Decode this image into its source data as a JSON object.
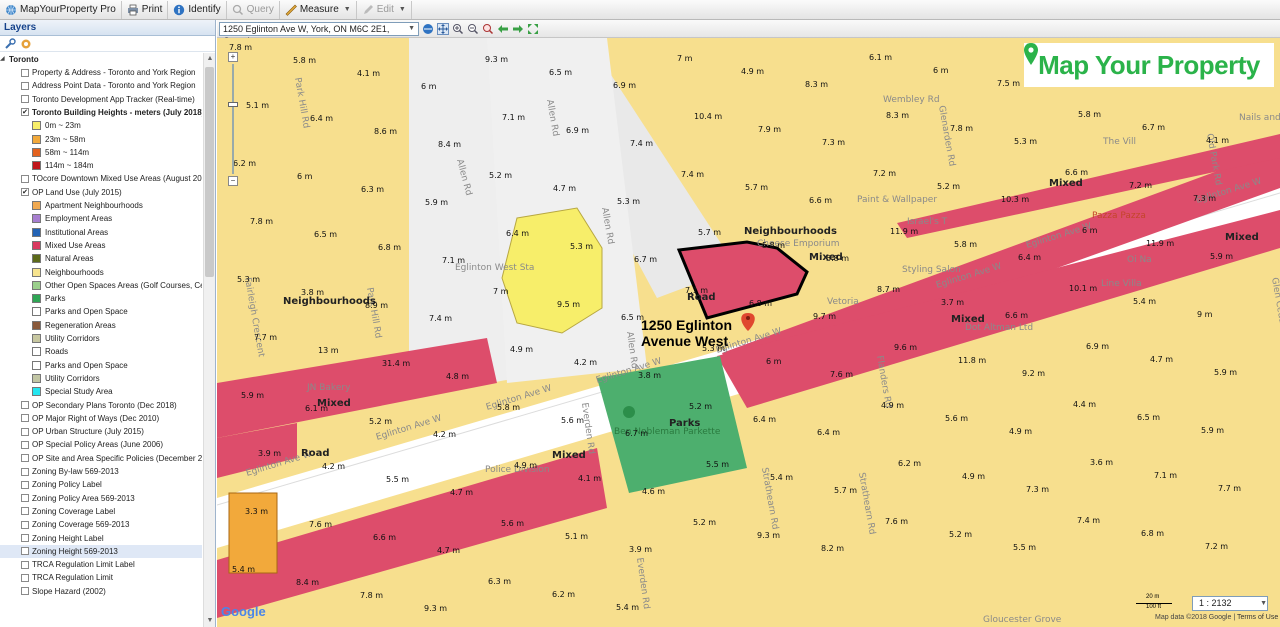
{
  "toolbar": {
    "app_name": "MapYourProperty Pro",
    "print": "Print",
    "identify": "Identify",
    "query": "Query",
    "measure": "Measure",
    "edit": "Edit"
  },
  "layers_panel": {
    "title": "Layers",
    "root": "Toronto",
    "items": [
      {
        "label": "Property & Address - Toronto and York Region",
        "checked": false
      },
      {
        "label": "Address Point Data - Toronto and York Region",
        "checked": false
      },
      {
        "label": "Toronto Development App Tracker (Real-time)",
        "checked": false
      },
      {
        "label": "Toronto Building Heights - meters (July 2018)",
        "checked": true,
        "bold": true
      },
      {
        "label": "0m ~ 23m",
        "swatch": "#f7ee6a",
        "legend": true
      },
      {
        "label": "23m ~ 58m",
        "swatch": "#f2a93b",
        "legend": true
      },
      {
        "label": "58m ~ 114m",
        "swatch": "#e3621e",
        "legend": true
      },
      {
        "label": "114m ~ 184m",
        "swatch": "#c0161b",
        "legend": true
      },
      {
        "label": "TOcore Downtown Mixed Use Areas (August 2018)",
        "checked": false
      },
      {
        "label": "OP Land Use (July 2015)",
        "checked": true
      },
      {
        "label": "Apartment Neighbourhoods",
        "swatch": "#f0a951",
        "legend": true
      },
      {
        "label": "Employment Areas",
        "swatch": "#a77ed0",
        "legend": true
      },
      {
        "label": "Institutional Areas",
        "swatch": "#2363b5",
        "legend": true
      },
      {
        "label": "Mixed Use Areas",
        "swatch": "#d9395f",
        "legend": true
      },
      {
        "label": "Natural Areas",
        "swatch": "#5c6a1a",
        "legend": true
      },
      {
        "label": "Neighbourhoods",
        "swatch": "#f7e48e",
        "legend": true
      },
      {
        "label": "Other Open Spaces Areas (Golf Courses, Ce",
        "swatch": "#9bd08c",
        "legend": true
      },
      {
        "label": "Parks",
        "swatch": "#2fa655",
        "legend": true
      },
      {
        "label": "Parks and Open Space",
        "swatch": "#ffffff",
        "legend": true
      },
      {
        "label": "Regeneration Areas",
        "swatch": "#8a5a3c",
        "legend": true
      },
      {
        "label": "Utility Corridors",
        "swatch": "#c7c7a0",
        "legend": true
      },
      {
        "label": "Roads",
        "swatch": "#ffffff",
        "legend": true
      },
      {
        "label": "Parks and Open Space",
        "swatch": "#ffffff",
        "legend": true
      },
      {
        "label": "Utility Corridors",
        "swatch": "#c2c6a4",
        "legend": true
      },
      {
        "label": "Special Study Area",
        "swatch": "#24e6f0",
        "legend": true
      },
      {
        "label": "OP Secondary Plans Toronto (Dec 2018)",
        "checked": false
      },
      {
        "label": "OP Major Right of Ways (Dec 2010)",
        "checked": false
      },
      {
        "label": "OP Urban Structure (July 2015)",
        "checked": false
      },
      {
        "label": "OP Special Policy Areas (June 2006)",
        "checked": false
      },
      {
        "label": "OP Site and Area Specific Policies (December 2018",
        "checked": false
      },
      {
        "label": "Zoning By-law 569-2013",
        "checked": false
      },
      {
        "label": "Zoning Policy Label",
        "checked": false
      },
      {
        "label": "Zoning Policy Area 569-2013",
        "checked": false
      },
      {
        "label": "Zoning Coverage Label",
        "checked": false
      },
      {
        "label": "Zoning Coverage 569-2013",
        "checked": false
      },
      {
        "label": "Zoning Height Label",
        "checked": false
      },
      {
        "label": "Zoning Height 569-2013",
        "checked": false,
        "selected": true
      },
      {
        "label": "TRCA Regulation Limit Label",
        "checked": false
      },
      {
        "label": "TRCA Regulation Limit",
        "checked": false
      },
      {
        "label": "Slope Hazard (2002)",
        "checked": false
      }
    ]
  },
  "map_toolbar": {
    "address": "1250 Eglinton Ave W, York, ON M6C 2E1, Canada"
  },
  "map": {
    "brand": "Map Your Property",
    "subject_line1": "1250 Eglinton",
    "subject_line2": "Avenue West",
    "scale_top": "20 m",
    "scale_bottom": "100 ft",
    "ratio": "1 : 2132",
    "google": "Google",
    "footer": "Map data ©2018 Google",
    "terms": "Terms of Use",
    "streets": {
      "allen_1": "Allen Rd",
      "allen_2": "Allen Rd",
      "allen_3": "Allen Rd",
      "allen_4": "Allen Rd",
      "eglinton_1": "Eglinton Ave W",
      "eglinton_2": "Eglinton Ave W",
      "eglinton_3": "Eglinton Ave W",
      "eglinton_4": "Eglinton Ave W",
      "eglinton_5": "Eglinton Ave W",
      "eglinton_6": "Eglinton Ave W",
      "eglinton_7": "Eglinton Ave W",
      "eglinton_8": "Eglinton Ave W",
      "eglinton_w": "Eglinton West Sta",
      "wembley": "Wembley Rd",
      "gloucester": "Gloucester Grove",
      "old_park": "Old Park Rd",
      "park_hill": "Park Hill Rd",
      "park_hill2": "Park Hill Rd",
      "fairleigh": "Fairleigh Crescent",
      "everden": "Everden Rd",
      "everden2": "Everden Rd",
      "strathearn": "Strathearn Rd",
      "strathearn2": "Strathearn Rd",
      "flanders": "Flanders Rd",
      "glenarden": "Glenarden Rd",
      "glen_cedar": "Glen Cedar Rd"
    },
    "zones": {
      "neighbourhoods_1": "Neighbourhoods",
      "neighbourhoods_2": "Neighbourhoods",
      "mixed_1": "Mixed",
      "mixed_2": "Mixed",
      "mixed_3": "Mixed",
      "mixed_4": "Mixed",
      "mixed_5": "Mixed",
      "mixed_6": "Mixed",
      "parks": "Parks",
      "road_1": "Road",
      "road_2": "Road"
    },
    "pois": {
      "park_name": "Ben Nobleman Parkette",
      "pazza": "Pazza Pazza",
      "vetoria": "Vetoria",
      "nails": "Nails and",
      "village": "The Vill",
      "police": "Police Division",
      "salon": "Styling Salon",
      "dot_altman": "Dot Altman Ltd",
      "israels": "Israel's T",
      "wallpaper": "Paint & Wallpaper",
      "cheese": "Cheese Emporium",
      "olna": "Oi Na",
      "lavilla": "Line Villa",
      "jnbakery": "JN Bakery"
    },
    "heights": [
      "7.8 m",
      "5.8 m",
      "4.1 m",
      "6 m",
      "9.3 m",
      "6.5 m",
      "6.9 m",
      "7 m",
      "4.9 m",
      "8.3 m",
      "6.1 m",
      "6 m",
      "7.5 m",
      "8.2 m",
      "6.8 m",
      "6.8 m",
      "5.1 m",
      "6.4 m",
      "8.6 m",
      "8.4 m",
      "7.1 m",
      "6.9 m",
      "7.4 m",
      "10.4 m",
      "7.9 m",
      "7.3 m",
      "8.3 m",
      "7.8 m",
      "5.3 m",
      "5.8 m",
      "6.7 m",
      "4.1 m",
      "6.2 m",
      "6 m",
      "6.3 m",
      "5.9 m",
      "5.2 m",
      "4.7 m",
      "5.3 m",
      "7.4 m",
      "5.7 m",
      "6.6 m",
      "7.2 m",
      "5.2 m",
      "10.3 m",
      "6.6 m",
      "7.2 m",
      "7.3 m",
      "7.8 m",
      "6.5 m",
      "6.8 m",
      "7.1 m",
      "6.4 m",
      "5.3 m",
      "6.7 m",
      "5.7 m",
      "5.8 m",
      "5.8 m",
      "11.9 m",
      "5.8 m",
      "6.4 m",
      "6 m",
      "11.9 m",
      "5.9 m",
      "5.3 m",
      "3.8 m",
      "8.9 m",
      "7.4 m",
      "7 m",
      "9.5 m",
      "6.5 m",
      "7.1 m",
      "6.8 m",
      "9.7 m",
      "8.7 m",
      "3.7 m",
      "6.6 m",
      "10.1 m",
      "5.4 m",
      "9 m",
      "7.7 m",
      "13 m",
      "31.4 m",
      "4.8 m",
      "4.9 m",
      "4.2 m",
      "3.8 m",
      "5.3 m",
      "6 m",
      "7.6 m",
      "9.6 m",
      "11.8 m",
      "9.2 m",
      "6.9 m",
      "4.7 m",
      "5.9 m",
      "5.9 m",
      "6.1 m",
      "5.2 m",
      "4.2 m",
      "5.8 m",
      "5.6 m",
      "6.7 m",
      "5.2 m",
      "6.4 m",
      "6.4 m",
      "4.9 m",
      "5.6 m",
      "4.9 m",
      "4.4 m",
      "6.5 m",
      "5.9 m",
      "3.9 m",
      "4.2 m",
      "5.5 m",
      "4.7 m",
      "4.9 m",
      "4.1 m",
      "4.6 m",
      "5.5 m",
      "5.4 m",
      "5.7 m",
      "6.2 m",
      "4.9 m",
      "7.3 m",
      "3.6 m",
      "7.1 m",
      "7.7 m",
      "3.3 m",
      "7.6 m",
      "6.6 m",
      "4.7 m",
      "5.6 m",
      "5.1 m",
      "3.9 m",
      "5.2 m",
      "9.3 m",
      "8.2 m",
      "7.6 m",
      "5.2 m",
      "5.5 m",
      "7.4 m",
      "6.8 m",
      "7.2 m",
      "5.4 m",
      "8.4 m",
      "7.8 m",
      "9.3 m",
      "6.3 m",
      "6.2 m",
      "5.4 m"
    ]
  }
}
